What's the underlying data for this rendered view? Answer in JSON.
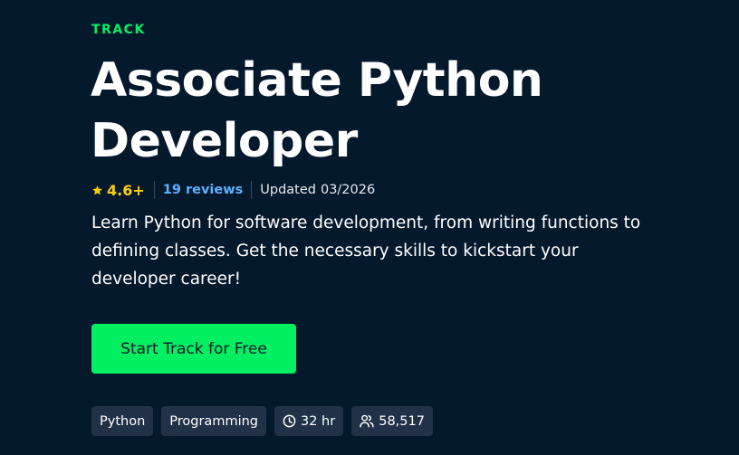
{
  "track": {
    "label": "TRACK",
    "title_line1": "Associate Python",
    "title_line2": "Developer",
    "rating": "4.6+",
    "reviews": "19 reviews",
    "updated_label": "Updated",
    "updated_date": "03/2026",
    "description": "Learn Python for software development, from writing functions to defining classes. Get the necessary skills to kickstart your developer career!",
    "cta_label": "Start Track for Free"
  },
  "tags": {
    "topic1": "Python",
    "topic2": "Programming",
    "duration": "32 hr",
    "learners": "58,517"
  },
  "icons": {
    "rating": "star-icon",
    "duration": "clock-icon",
    "learners": "users-icon"
  },
  "colors": {
    "background": "#05192d",
    "accent_green": "#03ef62",
    "rating_yellow": "#fcce0d",
    "link_blue": "#5eb1ff",
    "tag_background": "#213147"
  }
}
